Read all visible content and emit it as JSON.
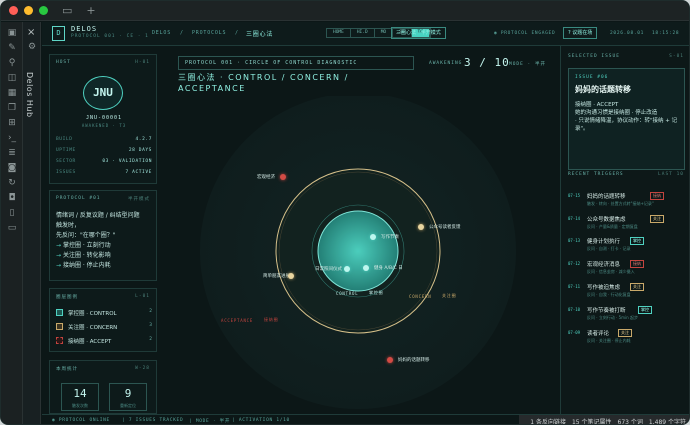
{
  "window": {
    "new_tab": "+"
  },
  "sidebar": {
    "vertical_label": "Delos Hub",
    "close": "×"
  },
  "header": {
    "logo": "D",
    "brand": "DELOS",
    "brand_sub": "PROTOCOL 001 · CE · 1",
    "crumbs": [
      "DELOS",
      "/",
      "PROTOCOLS",
      "/"
    ],
    "crumb_active": "三圈心法",
    "modes": [
      "HOME",
      "HI.D",
      "MO",
      "SO",
      "TC"
    ],
    "mode_active": "TC",
    "mode_button": "三圈心法 · 半开模式",
    "engaged": "◉ PROTOCOL ENGAGED",
    "issues_btn": "? 议题在场",
    "date": "2026.08.01",
    "time": "18:15:28"
  },
  "host": {
    "title": "HOST",
    "index": "H-01",
    "avatar": "JNU",
    "id": "JNU-00001",
    "role": "AWAKENED · T3",
    "rows": [
      {
        "k": "BUILD",
        "v": "4.2.7"
      },
      {
        "k": "UPTIME",
        "v": "28 DAYS"
      },
      {
        "k": "SECTOR",
        "v": "03 · VALIDATION"
      },
      {
        "k": "ISSUES",
        "v": "7 ACTIVE"
      }
    ]
  },
  "protocol": {
    "title": "PROTOCOL #01",
    "index": "半开模式",
    "line1": "情绪词 / 反复议题 / 纠结型问题",
    "line2": "触发时，",
    "line3": "先反问：\"在哪个圈？\"",
    "steps": [
      {
        "arrow": "→",
        "text": "掌控圈 · 立刻行动"
      },
      {
        "arrow": "→",
        "text": "关注圈 · 转化影响"
      },
      {
        "arrow": "→",
        "text": "接纳圈 · 停止内耗"
      }
    ]
  },
  "legend": {
    "title": "圈层图例",
    "index": "L-01",
    "items": [
      {
        "label": "掌控圈 · CONTROL",
        "count": "2",
        "color": "#4fd1c1"
      },
      {
        "label": "关注圈 · CONCERN",
        "count": "3",
        "color": "#c9a96a"
      },
      {
        "label": "接纳圈 · ACCEPT",
        "count": "2",
        "color": "#c4443f"
      }
    ]
  },
  "weekly": {
    "title": "本周统计",
    "index": "W-28",
    "stats": [
      {
        "value": "14",
        "label": "触发次数"
      },
      {
        "value": "9",
        "label": "重新定位"
      }
    ]
  },
  "diagram": {
    "header": "PROTOCOL 001 · CIRCLE OF CONTROL DIAGNOSTIC",
    "awakening_label": "AWAKENING",
    "awakening_value": "3 / 10",
    "mode": "MODE · 半开",
    "title": "三圈心法 · CONTROL / CONCERN / ACCEPTANCE",
    "ring_labels": {
      "control": "CONTROL",
      "control_cn": "掌控圈",
      "concern": "CONCERN",
      "concern_cn": "关注圈",
      "accept": "ACCEPTANCE",
      "accept_cn": "接纳圈"
    },
    "nodes": [
      {
        "label": "写作节奏",
        "ring": "control"
      },
      {
        "label": "健身 A/B/C 日",
        "ring": "control"
      },
      {
        "label": "日常照间仪式",
        "ring": "control"
      },
      {
        "label": "公众号读者反馈",
        "ring": "concern"
      },
      {
        "label": "简单朋友进展",
        "ring": "concern"
      },
      {
        "label": "宏观经济",
        "ring": "accept"
      },
      {
        "label": "妈妈的话题转移",
        "ring": "accept"
      }
    ]
  },
  "selected": {
    "title": "SELECTED ISSUE",
    "index": "S-01",
    "no": "ISSUE #06",
    "name": "妈妈的话题转移",
    "body": "接纳圈 · ACCEPT\n她的沟通习惯是接纳圈 · 停止改造\n· 只说情绪降温，协议动作：转\"接纳 + 记录\"。"
  },
  "triggers": {
    "title": "RECENT TRIGGERS",
    "index": "LAST 10",
    "items": [
      {
        "date": "07-15",
        "title": "妈妈的话题转移",
        "tag": "接纳",
        "sub": "触发 · 转向 · 处置方式转\"接纳+记录\""
      },
      {
        "date": "07-14",
        "title": "公众号数据焦虑",
        "tag": "关注",
        "sub": "反问 · 产量&质量 · 定期复盘"
      },
      {
        "date": "07-13",
        "title": "健身计划执行",
        "tag": "掌控",
        "sub": "反问 · 自测 · 打卡 · 记录"
      },
      {
        "date": "07-12",
        "title": "宏观经济消息",
        "tag": "接纳",
        "sub": "反问 · 信息茧房 · 减少摄入"
      },
      {
        "date": "07-11",
        "title": "写作被迫焦虑",
        "tag": "关注",
        "sub": "反问 · 自我 · 行动化复盘"
      },
      {
        "date": "07-10",
        "title": "写作节奏被打断",
        "tag": "掌控",
        "sub": "反问 · 立刻行动 · 5min 起步"
      },
      {
        "date": "07-09",
        "title": "读者评论",
        "tag": "关注",
        "sub": "反问 · 关注圈 · 停止内耗"
      }
    ]
  },
  "footer": {
    "items": [
      "◉ PROTOCOL ONLINE",
      "| 7 ISSUES TRACKED",
      "| MODE · 半开",
      "| ACTIVATION 1/10"
    ],
    "status": [
      "1 条反向链接",
      "15 个笔记属性",
      "673 个词",
      "1,489 个字符"
    ]
  },
  "colors": {
    "accent": "#4fd1c1",
    "concern": "#c9a96a",
    "accept": "#c4443f",
    "bg": "#0c1717"
  }
}
